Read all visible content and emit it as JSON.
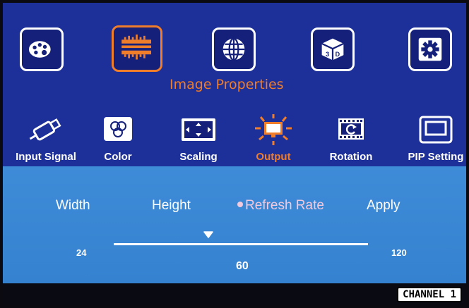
{
  "colors": {
    "top_bg": "#1d2f99",
    "panel_bg": "#3e8bd8",
    "accent": "#f07d2a",
    "selected_param": "#f3c9dd"
  },
  "top_menu": [
    {
      "icon": "palette-icon",
      "selected": false
    },
    {
      "icon": "image-properties-icon",
      "selected": true
    },
    {
      "icon": "globe-icon",
      "selected": false
    },
    {
      "icon": "3d-cube-icon",
      "selected": false
    },
    {
      "icon": "gear-icon",
      "selected": false
    }
  ],
  "section_title": "Image Properties",
  "sub_tabs": [
    {
      "label": "Input Signal",
      "icon": "usb-cable-icon"
    },
    {
      "label": "Color",
      "icon": "rgb-circles-icon"
    },
    {
      "label": "Scaling",
      "icon": "scaling-arrows-icon"
    },
    {
      "label": "Output",
      "icon": "monitor-rays-icon",
      "selected": true
    },
    {
      "label": "Rotation",
      "icon": "rotation-icon"
    },
    {
      "label": "PIP Setting",
      "icon": "pip-window-icon"
    }
  ],
  "params": {
    "width": "Width",
    "height": "Height",
    "refresh_rate": "Refresh Rate",
    "apply": "Apply",
    "selected": "refresh_rate"
  },
  "slider": {
    "min": "24",
    "max": "120",
    "value": "60"
  },
  "channel": "CHANNEL 1"
}
